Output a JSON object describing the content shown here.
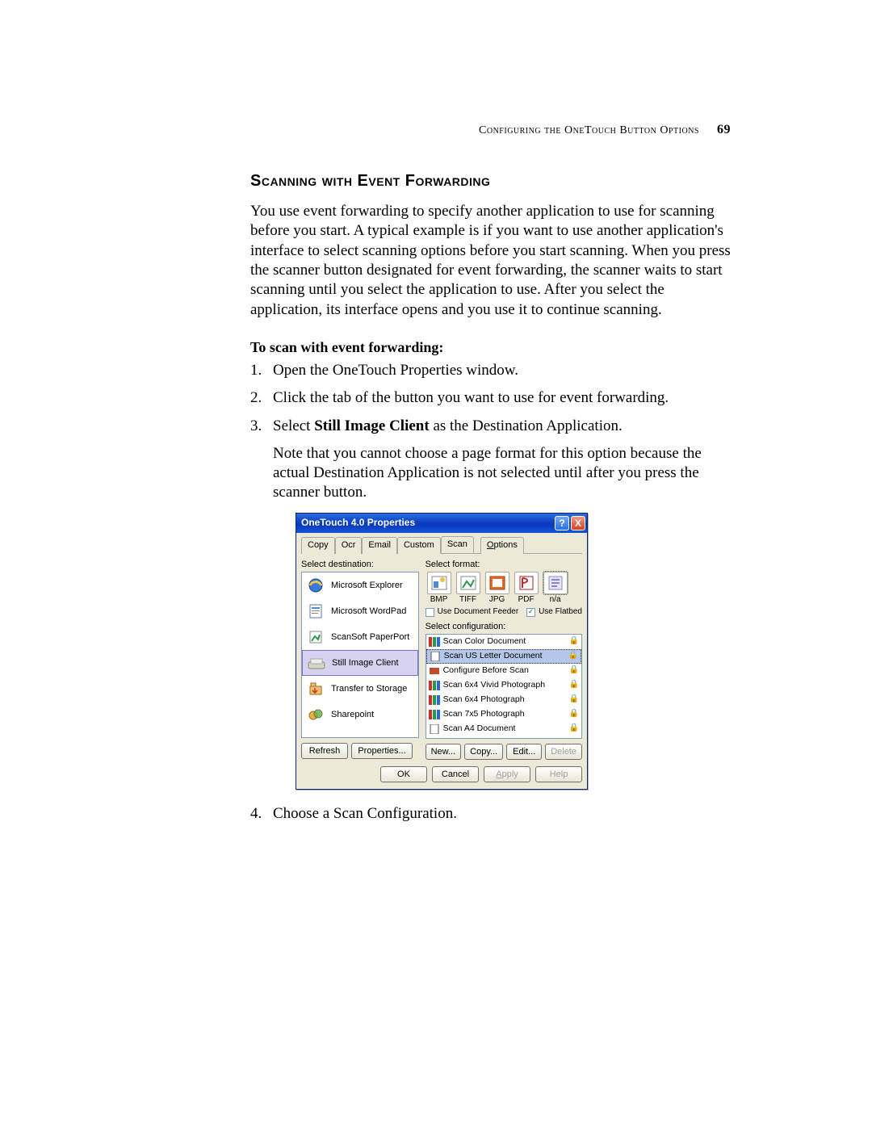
{
  "page": {
    "running_head": "Configuring the OneTouch Button Options",
    "number": "69"
  },
  "section": {
    "title": "Scanning with Event Forwarding",
    "para1": "You use event forwarding to specify another application to use for scanning before you start. A typical example is if you want to use another application's interface to select scanning options before you start scanning. When you press the scanner button designated for event forwarding, the scanner waits to start scanning until you select the application to use. After you select the application, its interface opens and you use it to continue scanning.",
    "sub": "To scan with event forwarding:",
    "steps": {
      "s1": "Open the OneTouch Properties window.",
      "s2": "Click the tab of the button you want to use for event forwarding.",
      "s3a": "Select ",
      "s3b": "Still Image Client",
      "s3c": " as the Destination Application.",
      "s3note": "Note that you cannot choose a page format for this option because the actual Destination Application is not selected until after you press the scanner button.",
      "s4": "Choose a Scan Configuration."
    }
  },
  "dialog": {
    "title": "OneTouch 4.0 Properties",
    "titlebar": {
      "help": "?",
      "close": "X"
    },
    "tabs": {
      "copy": "Copy",
      "ocr": "Ocr",
      "email": "Email",
      "custom": "Custom",
      "scan": "Scan",
      "options_u": "O",
      "options_rest": "ptions"
    },
    "labels": {
      "dest": "Select destination:",
      "fmt": "Select format:",
      "cfg": "Select configuration:"
    },
    "dest": {
      "items": [
        {
          "label": "Microsoft Explorer"
        },
        {
          "label": "Microsoft WordPad"
        },
        {
          "label": "ScanSoft PaperPort"
        },
        {
          "label": "Still Image Client"
        },
        {
          "label": "Transfer to Storage"
        },
        {
          "label": "Sharepoint"
        }
      ]
    },
    "formats": {
      "items": [
        {
          "label": "BMP"
        },
        {
          "label": "TIFF"
        },
        {
          "label": "JPG"
        },
        {
          "label": "PDF"
        },
        {
          "label": "n/a"
        }
      ],
      "feeder": "Use Document Feeder",
      "flatbed": "Use Flatbed"
    },
    "configs": {
      "items": [
        {
          "label": "Scan Color Document"
        },
        {
          "label": "Scan US Letter Document"
        },
        {
          "label": "Configure Before Scan"
        },
        {
          "label": "Scan 6x4 Vivid Photograph"
        },
        {
          "label": "Scan 6x4 Photograph"
        },
        {
          "label": "Scan 7x5 Photograph"
        },
        {
          "label": "Scan A4 Document"
        }
      ]
    },
    "buttons": {
      "refresh": "Refresh",
      "properties": "Properties...",
      "new": "New...",
      "copy": "Copy...",
      "edit": "Edit...",
      "delete": "Delete",
      "ok": "OK",
      "cancel": "Cancel",
      "apply_u": "A",
      "apply_rest": "pply",
      "help": "Help"
    }
  }
}
